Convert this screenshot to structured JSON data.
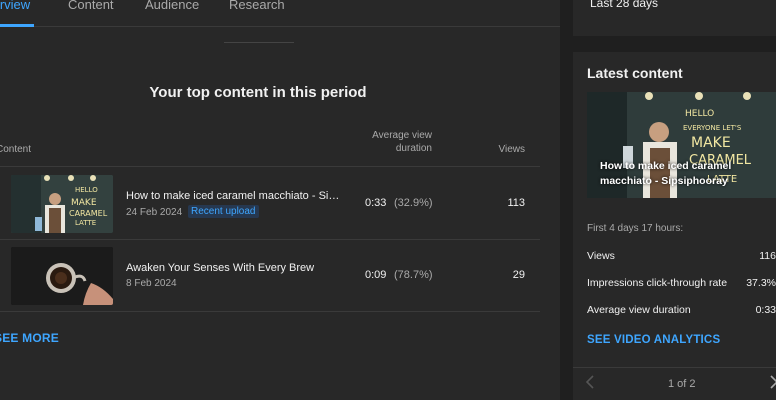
{
  "tabs": [
    {
      "label": "Overview"
    },
    {
      "label": "Content"
    },
    {
      "label": "Audience"
    },
    {
      "label": "Research"
    }
  ],
  "top_content": {
    "title": "Your top content in this period",
    "columns": {
      "content": "Content",
      "avg_view_duration": "Average view duration",
      "views": "Views"
    },
    "rows": [
      {
        "title": "How to make iced caramel macchiato - Sipsiphooray",
        "date": "24 Feb 2024",
        "badge": "Recent upload",
        "duration": "0:33",
        "percent": "(32.9%)",
        "views": "113"
      },
      {
        "title": "Awaken Your Senses With Every Brew",
        "date": "8 Feb 2024",
        "badge": "",
        "duration": "0:09",
        "percent": "(78.7%)",
        "views": "29"
      }
    ],
    "see_more": "SEE MORE"
  },
  "date_range": {
    "label": "Last 28 days"
  },
  "latest_content": {
    "title": "Latest content",
    "video_title": "How to make iced caramel macchiato - Sipsiphooray",
    "period": "First 4 days 17 hours:",
    "metrics": [
      {
        "label": "Views",
        "value": "116"
      },
      {
        "label": "Impressions click-through rate",
        "value": "37.3%"
      },
      {
        "label": "Average view duration",
        "value": "0:33"
      }
    ],
    "analytics_link": "SEE VIDEO ANALYTICS",
    "pager": "1 of 2"
  },
  "colors": {
    "accent": "#3ea6ff",
    "background": "#1f1f1f",
    "card": "#282828"
  }
}
